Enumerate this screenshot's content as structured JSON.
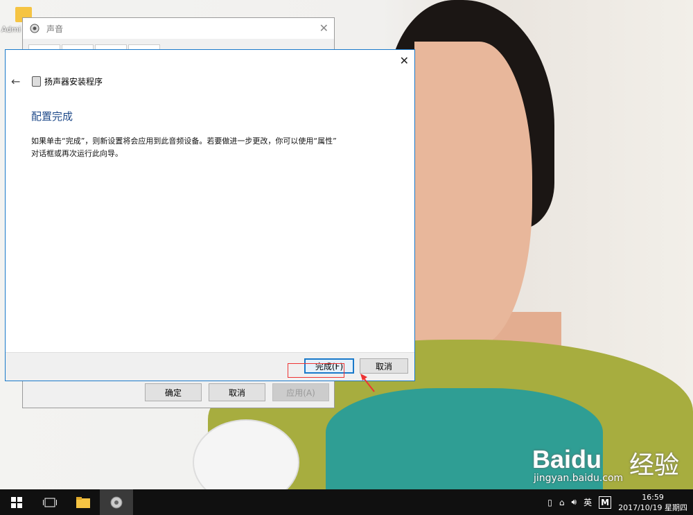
{
  "desktop": {
    "icon_label": "Admi"
  },
  "sound_window": {
    "title": "声音",
    "buttons": {
      "ok": "确定",
      "cancel": "取消",
      "apply": "应用(A)"
    }
  },
  "wizard": {
    "title": "扬声器安装程序",
    "heading": "配置完成",
    "body_line1": "如果单击“完成”，则新设置将会应用到此音频设备。若要做进一步更改，你可以使用“属性”",
    "body_line2": "对话框或再次运行此向导。",
    "finish_label": "完成(F)",
    "cancel_label": "取消"
  },
  "watermark": {
    "logo": "Baidu",
    "text": "经验",
    "url": "jingyan.baidu.com"
  },
  "taskbar": {
    "ime_label": "英",
    "ime_mode": "M",
    "time": "16:59",
    "date": "2017/10/19 星期四"
  },
  "colors": {
    "accent": "#1979ca",
    "annotation": "#e33333",
    "taskbar": "#101010"
  }
}
